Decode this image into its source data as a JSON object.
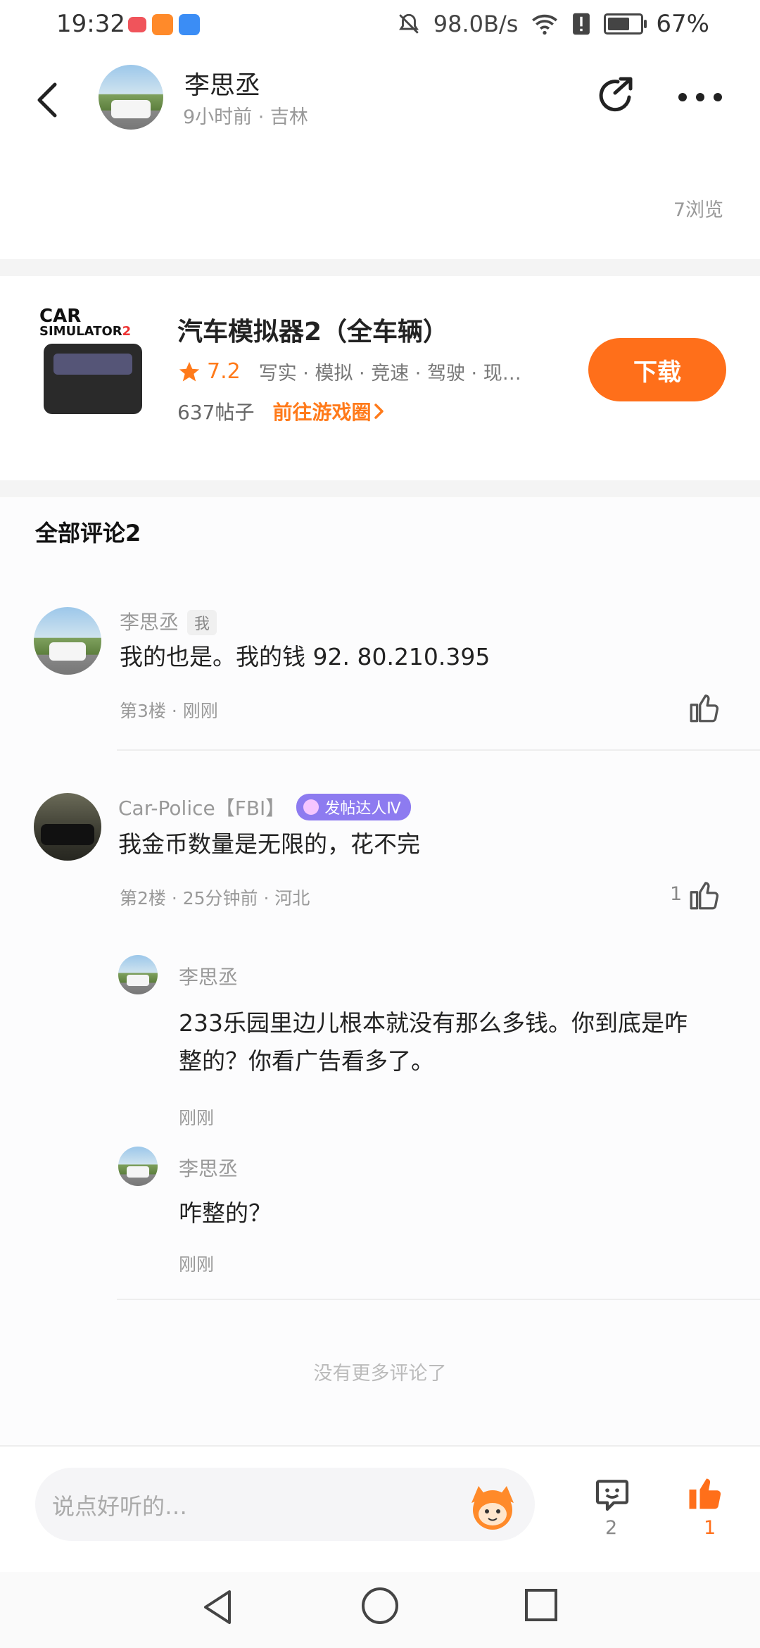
{
  "status_bar": {
    "time": "19:32",
    "net_speed": "98.0B/s",
    "battery": "67%",
    "icons": [
      "book-app-icon",
      "video-app-icon",
      "cloud-app-icon",
      "mute-icon",
      "wifi-icon",
      "alert-icon",
      "battery-icon"
    ]
  },
  "header": {
    "author_name": "李思丞",
    "author_meta": "9小时前 · 吉林",
    "views": "7浏览"
  },
  "game": {
    "logo_text_line1": "CAR",
    "logo_text_line2": "SIMULATOR",
    "logo_text_num": "2",
    "title": "汽车模拟器2（全车辆）",
    "rating": "7.2",
    "tags": "写实 · 模拟 · 竞速 · 驾驶 · 现…",
    "posts": "637帖子",
    "circle_link": "前往游戏圈",
    "download_label": "下载",
    "accent_color": "#ff6f1a"
  },
  "comments": {
    "title": "全部评论2",
    "items": [
      {
        "name": "李思丞",
        "tag": "我",
        "text": "我的也是。我的钱 92. 80.210.395",
        "meta": "第3楼 · 刚刚",
        "likes": ""
      },
      {
        "name": "Car-Police【FBI】",
        "badge": "发帖达人Ⅳ",
        "text": "我金币数量是无限的，花不完",
        "meta": "第2楼 · 25分钟前 · 河北",
        "likes": "1",
        "replies": [
          {
            "name": "李思丞",
            "text_line1": "233乐园里边儿根本就没有那么多钱。你到底是咋",
            "text_line2": "整的？你看广告看多了。",
            "meta": "刚刚"
          },
          {
            "name": "李思丞",
            "text_line1": "咋整的？",
            "meta": "刚刚"
          }
        ]
      }
    ],
    "no_more": "没有更多评论了"
  },
  "bottom_bar": {
    "input_placeholder": "说点好听的…",
    "comment_count": "2",
    "like_count": "1"
  }
}
